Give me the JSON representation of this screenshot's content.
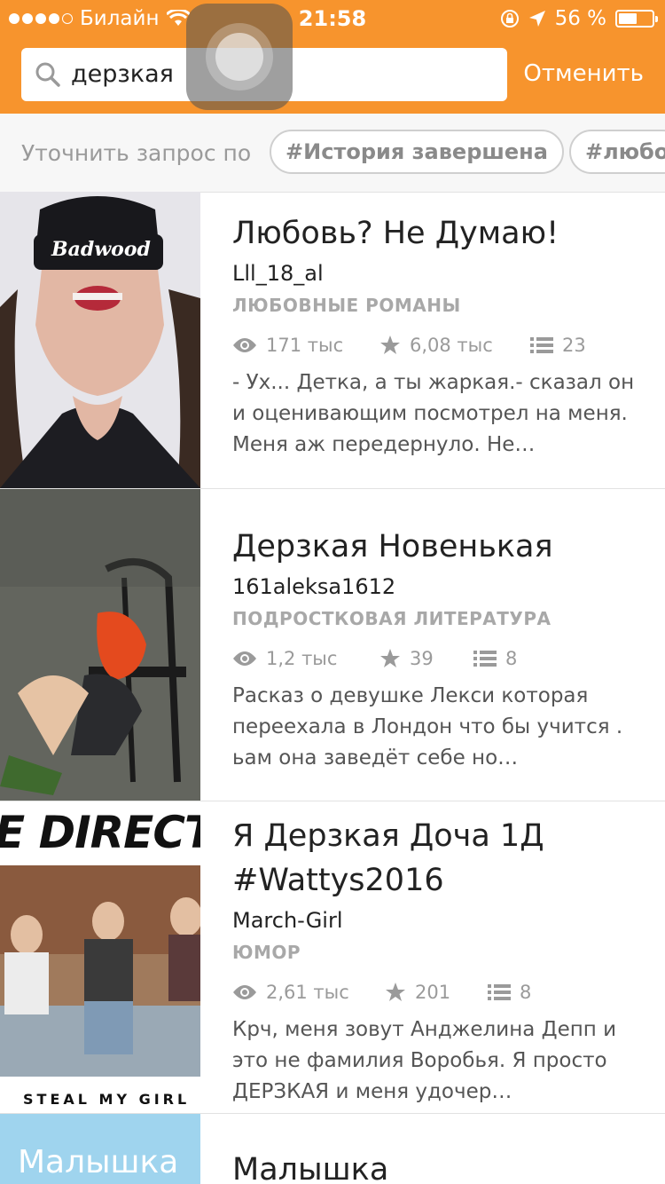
{
  "status": {
    "carrier": "Билайн",
    "time": "21:58",
    "battery": "56 %"
  },
  "search": {
    "query": "дерзкая",
    "cancel_label": "Отменить"
  },
  "filter": {
    "label": "Уточнить запрос по",
    "tags": [
      "#История завершена",
      "#любо"
    ]
  },
  "stories": [
    {
      "title": "Любовь? Не Думаю!",
      "author": "Lll_18_al",
      "genre": "ЛЮБОВНЫЕ РОМАНЫ",
      "reads": "171 тыс",
      "votes": "6,08 тыс",
      "parts": "23",
      "description": "- Ух... Детка, а ты жаркая.- сказал он и оценивающим посмотрел на меня. Меня аж передернуло. Не…",
      "cover_text": "Badwood"
    },
    {
      "title": "Дерзкая Новенькая",
      "author": "161aleksa1612",
      "genre": "ПОДРОСТКОВАЯ ЛИТЕРАТУРА",
      "reads": "1,2 тыс",
      "votes": "39",
      "parts": "8",
      "description": "Расказ о девушке Лекси которая переехала в Лондон что бы учится . ьам она заведёт себе но…"
    },
    {
      "title": "Я Дерзкая Доча 1Д #Wattys2016",
      "author": "March-Girl",
      "genre": "ЮМОР",
      "reads": "2,61 тыс",
      "votes": "201",
      "parts": "8",
      "description": "Крч, меня зовут Анджелина Депп и это не фамилия Воробья. Я просто ДЕРЗКАЯ и меня удочер…",
      "cover_text_top": "E DIRECT",
      "cover_text_bottom": "STEAL MY GIRL"
    },
    {
      "title": "Малышка",
      "cover_text": "Малышка"
    }
  ],
  "colors": {
    "accent": "#f7942d",
    "meta": "#9a9a9a"
  }
}
